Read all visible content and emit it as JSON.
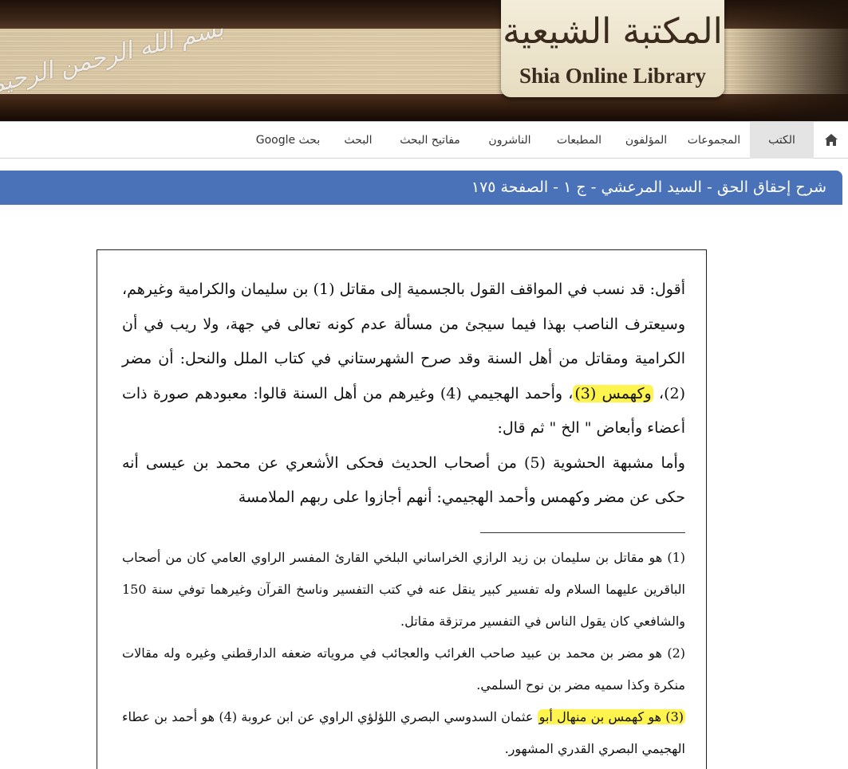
{
  "header": {
    "logo_arabic": "المكتبة الشيعية",
    "logo_english": "Shia Online Library",
    "calligraphy": "بسم الله الرحمن الرحيم"
  },
  "nav": {
    "home_icon": "home-icon",
    "items": [
      {
        "label": "الكتب",
        "active": true
      },
      {
        "label": "المجموعات"
      },
      {
        "label": "المؤلفون"
      },
      {
        "label": "المطبعات"
      },
      {
        "label": "الناشرون"
      },
      {
        "label": "مفاتيح البحث"
      },
      {
        "label": "البحث"
      },
      {
        "label": "بحث Google"
      }
    ]
  },
  "page_title": "شرح إحقاق الحق - السيد المرعشي - ج ١ - الصفحة ١٧٥",
  "highlight_color": "#fff34d",
  "title_bar_color": "#4a72b8",
  "content": {
    "p1_a": "أقول: قد نسب في المواقف القول بالجسمية إلى مقاتل (1) بن سليمان والكرامية وغيرهم، وسيعترف الناصب بهذا فيما سيجئ من مسألة عدم كونه تعالى في جهة، ولا ريب في أن الكرامية ومقاتل من أهل السنة وقد صرح الشهرستاني في كتاب الملل والنحل: أن مضر (2)، ",
    "p1_hl": "وكهمس (3)",
    "p1_b": "، وأحمد الهجيمي (4) وغيرهم من أهل السنة قالوا: معبودهم صورة ذات أعضاء وأبعاض \" الخ \" ثم قال:",
    "p2": "وأما مشبهة الحشوية (5) من أصحاب الحديث فحكى الأشعري عن محمد بن عيسى أنه حكى عن مضر وكهمس وأحمد الهجيمي: أنهم أجازوا على ربهم الملامسة",
    "fn1": "(1) هو مقاتل بن سليمان بن زيد الرازي الخراساني البلخي القارئ المفسر الراوي العامي كان من أصحاب الباقرين عليهما السلام وله تفسير كبير ينقل عنه في كتب التفسير وناسخ القرآن وغيرهما توفي سنة 150 والشافعي كان يقول الناس في التفسير مرتزقة مقاتل.",
    "fn2": "(2) هو مضر بن محمد بن عبيد صاحب الغرائب والعجائب في مروياته ضعفه الدارقطني وغيره وله مقالات منكرة وكذا سميه مضر بن نوح السلمي.",
    "fn3_hl": "(3) هو كهمس بن منهال أبو",
    "fn3_rest": " عثمان السدوسي البصري اللؤلؤي الراوي عن ابن عروبة (4) هو أحمد بن عطاء الهجيمي البصري القدري المشهور."
  }
}
